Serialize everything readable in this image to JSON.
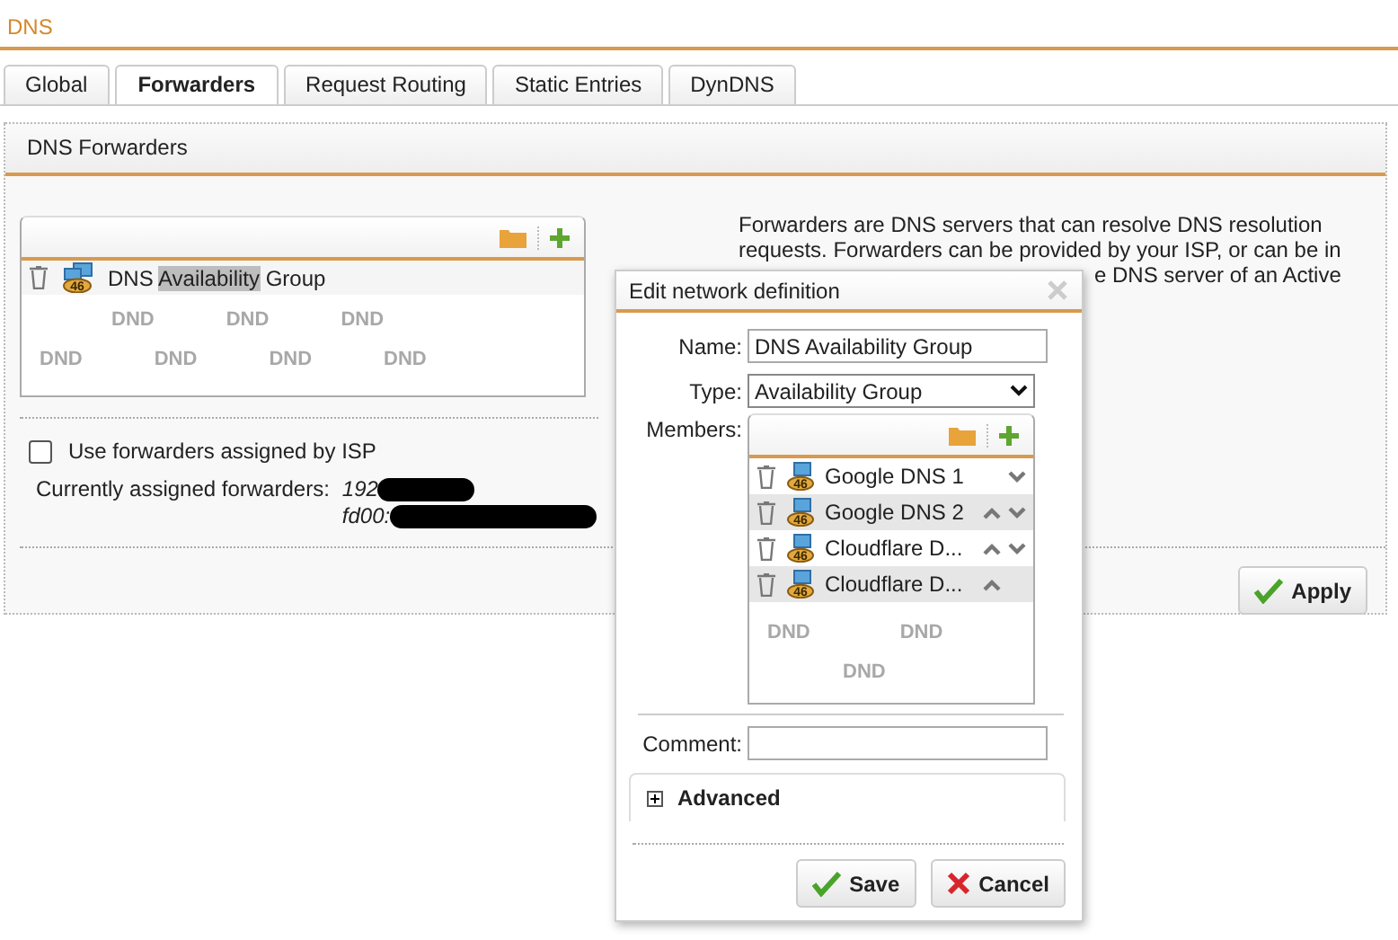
{
  "page_title": "DNS",
  "tabs": [
    {
      "label": "Global",
      "selected": false
    },
    {
      "label": "Forwarders",
      "selected": true
    },
    {
      "label": "Request Routing",
      "selected": false
    },
    {
      "label": "Static Entries",
      "selected": false
    },
    {
      "label": "DynDNS",
      "selected": false
    }
  ],
  "panel": {
    "title": "DNS Forwarders",
    "forwarders_list": {
      "items": [
        {
          "badge": "46",
          "name_parts": [
            {
              "text": "DNS ",
              "highlighted": false
            },
            {
              "text": "Availability",
              "highlighted": true
            },
            {
              "text": " Group",
              "highlighted": false
            }
          ]
        }
      ],
      "drop_marks": [
        [
          "DND",
          "DND",
          "DND"
        ],
        [
          "DND",
          "DND",
          "DND",
          "DND"
        ]
      ]
    },
    "use_isp": {
      "label": "Use forwarders assigned by ISP",
      "checked": false
    },
    "assigned": {
      "label": "Currently assigned forwarders:",
      "values": [
        "192",
        "fd00:"
      ]
    },
    "help_lines": [
      "Forwarders are DNS servers that can resolve DNS resolution",
      "requests. Forwarders can be provided by your ISP, or can be in",
      "e DNS server of an Active"
    ],
    "apply_button": "Apply"
  },
  "dialog": {
    "title": "Edit network definition",
    "name": {
      "label": "Name:",
      "value": "DNS Availability Group"
    },
    "type": {
      "label": "Type:",
      "value": "Availability Group"
    },
    "members": {
      "label": "Members:",
      "items": [
        {
          "badge": "46",
          "name": "Google DNS 1",
          "can_move_up": false,
          "can_move_down": true
        },
        {
          "badge": "46",
          "name": "Google DNS 2",
          "can_move_up": true,
          "can_move_down": true
        },
        {
          "badge": "46",
          "name": "Cloudflare D...",
          "can_move_up": true,
          "can_move_down": true
        },
        {
          "badge": "46",
          "name": "Cloudflare D...",
          "can_move_up": true,
          "can_move_down": false
        }
      ],
      "drop_marks": [
        [
          "DND",
          "DND"
        ],
        [
          "DND"
        ]
      ]
    },
    "comment": {
      "label": "Comment:"
    },
    "advanced": {
      "label": "Advanced",
      "expanded": false
    },
    "buttons": [
      {
        "kind": "save",
        "label": "Save"
      },
      {
        "kind": "cancel",
        "label": "Cancel"
      }
    ]
  }
}
